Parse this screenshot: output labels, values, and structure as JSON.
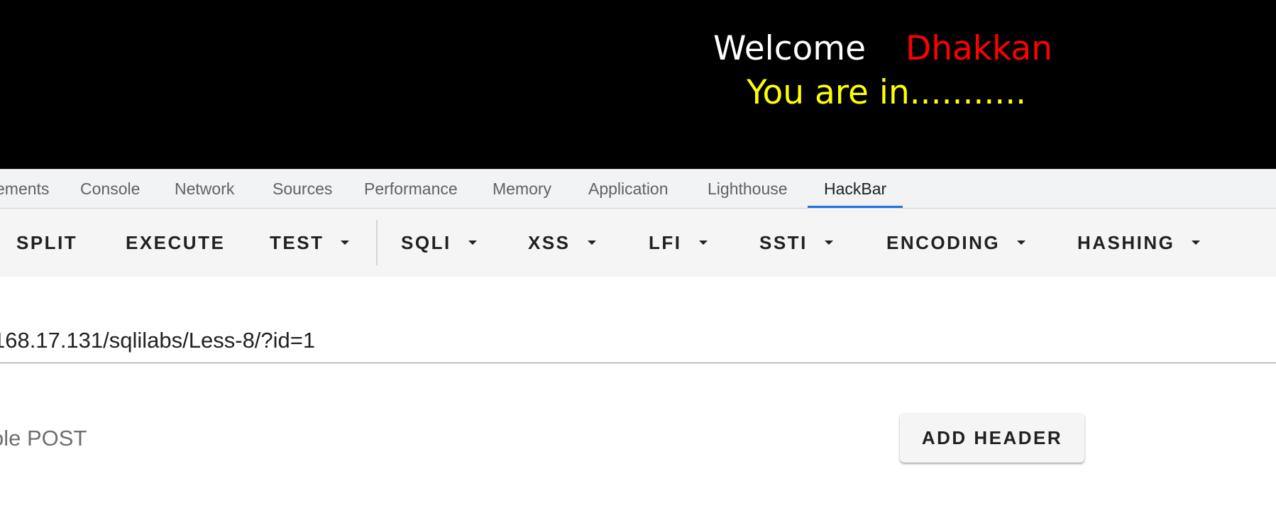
{
  "banner": {
    "welcome_word": "Welcome",
    "user_name": "Dhakkan",
    "status_text": "You are in..........."
  },
  "devtools": {
    "tabs": [
      {
        "label": "ements"
      },
      {
        "label": "Console"
      },
      {
        "label": "Network"
      },
      {
        "label": "Sources"
      },
      {
        "label": "Performance"
      },
      {
        "label": "Memory"
      },
      {
        "label": "Application"
      },
      {
        "label": "Lighthouse"
      },
      {
        "label": "HackBar"
      }
    ],
    "active_tab": "HackBar",
    "accent_color": "#1a73e8"
  },
  "hackbar": {
    "buttons": [
      {
        "label": "SPLIT",
        "dropdown": false
      },
      {
        "label": "EXECUTE",
        "dropdown": false
      },
      {
        "label": "TEST",
        "dropdown": true
      },
      {
        "label": "SQLI",
        "dropdown": true
      },
      {
        "label": "XSS",
        "dropdown": true
      },
      {
        "label": "LFI",
        "dropdown": true
      },
      {
        "label": "SSTI",
        "dropdown": true
      },
      {
        "label": "ENCODING",
        "dropdown": true
      },
      {
        "label": "HASHING",
        "dropdown": true
      }
    ],
    "url_value": "168.17.131/sqlilabs/Less-8/?id=1",
    "enable_post_label": "ole POST",
    "add_header_label": "ADD HEADER"
  },
  "colors": {
    "banner_bg": "#000000",
    "welcome_color": "#ffffff",
    "name_color": "#ff0000",
    "status_color": "#ffff00"
  }
}
